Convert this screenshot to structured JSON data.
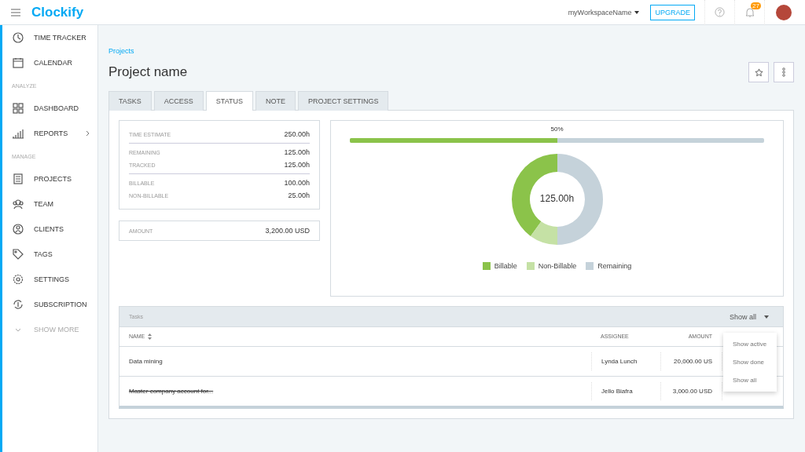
{
  "topbar": {
    "logo": "Clockify",
    "workspace": "myWorkspaceName",
    "upgrade": "UPGRADE",
    "notifications": "27"
  },
  "sidebar": {
    "items": [
      {
        "kind": "item",
        "label": "TIME TRACKER"
      },
      {
        "kind": "item",
        "label": "CALENDAR"
      },
      {
        "kind": "section",
        "label": "ANALYZE"
      },
      {
        "kind": "item",
        "label": "DASHBOARD"
      },
      {
        "kind": "submenu",
        "label": "REPORTS"
      },
      {
        "kind": "section",
        "label": "MANAGE"
      },
      {
        "kind": "item",
        "label": "PROJECTS"
      },
      {
        "kind": "item",
        "label": "TEAM"
      },
      {
        "kind": "item",
        "label": "CLIENTS"
      },
      {
        "kind": "item",
        "label": "TAGS"
      },
      {
        "kind": "item",
        "label": "SETTINGS"
      },
      {
        "kind": "item",
        "label": "SUBSCRIPTION"
      },
      {
        "kind": "more",
        "label": "SHOW MORE"
      }
    ]
  },
  "breadcrumb": "Projects",
  "title": "Project name",
  "tabs": [
    {
      "label": "TASKS",
      "selected": false
    },
    {
      "label": "ACCESS",
      "selected": false
    },
    {
      "label": "STATUS",
      "selected": true
    },
    {
      "label": "NOTE",
      "selected": false
    },
    {
      "label": "PROJECT SETTINGS",
      "selected": false
    }
  ],
  "summary": [
    [
      {
        "label": "TIME ESTIMATE",
        "value": "250.00h"
      }
    ],
    [
      {
        "label": "REMAINING",
        "value": "125.00h"
      },
      {
        "label": "TRACKED",
        "value": "125.00h"
      }
    ],
    [
      {
        "label": "BILLABLE",
        "value": "100.00h"
      },
      {
        "label": "NON-BILLABLE",
        "value": "25.00h"
      }
    ]
  ],
  "amount": {
    "label": "AMOUNT",
    "value": "3,200.00 USD"
  },
  "progress": {
    "label": "50%",
    "level": 0.5
  },
  "chart_data": {
    "type": "donut",
    "categories": [
      "Billable",
      "Non-Billable",
      "Remaining"
    ],
    "values": [
      40,
      10,
      50
    ],
    "colors": [
      "#8bc34a",
      "#c5e1a5",
      "#c5d2da"
    ]
  },
  "donut_total": "125.00h",
  "tasks": {
    "title": "Tasks",
    "filter": "Show all",
    "columns": [
      "NAME",
      "ASSIGNEE",
      "AMOUNT"
    ],
    "rows": [
      {
        "name": "Data mining",
        "done": false,
        "assignee": "Lynda Lunch",
        "amount": "20,000.00 US"
      },
      {
        "name": "Master company account for...",
        "done": true,
        "assignee": "Jello Biafra",
        "amount": "3,000.00 USD"
      }
    ],
    "menu": [
      {
        "label": "Show active",
        "selected": false
      },
      {
        "label": "Show done",
        "selected": false
      },
      {
        "label": "Show all",
        "selected": false
      }
    ]
  }
}
